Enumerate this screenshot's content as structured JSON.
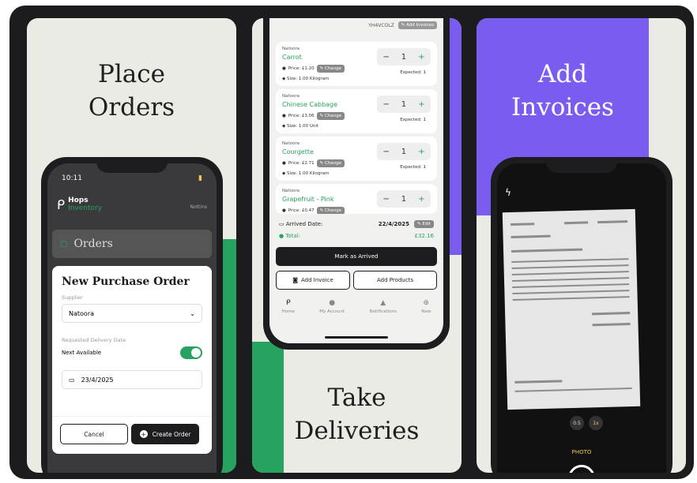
{
  "panel1": {
    "headline_line1": "Place",
    "headline_line2": "Orders",
    "status_time": "10:11",
    "logo_top": "Hops",
    "logo_bottom": "Inventory",
    "header_right": "Nottins",
    "orders_title": "Orders",
    "modal_title": "New Purchase Order",
    "supplier_label": "Supplier",
    "supplier_value": "Natoora",
    "delivery_label": "Requested Delivery Date",
    "next_available_label": "Next Available",
    "next_available_on": true,
    "date_value": "23/4/2025",
    "cancel_label": "Cancel",
    "create_label": "Create Order"
  },
  "panel2": {
    "headline_line1": "Take",
    "headline_line2": "Deliveries",
    "top_ref": "YH4VCOLZ",
    "add_invoices_label": "Add Invoices",
    "items": [
      {
        "supplier": "Natoora",
        "name": "Carrot",
        "price": "Price: £1.20",
        "size": "Size: 1.00 Kilogram",
        "qty": "1",
        "expected": "Expected: 1"
      },
      {
        "supplier": "Natoora",
        "name": "Chinese Cabbage",
        "price": "Price: £3.06",
        "size": "Size: 1.00 Unit",
        "qty": "1",
        "expected": "Expected: 1"
      },
      {
        "supplier": "Natoora",
        "name": "Courgette",
        "price": "Price: £2.71",
        "size": "Size: 1.00 Kilogram",
        "qty": "1",
        "expected": "Expected: 1"
      },
      {
        "supplier": "Natoora",
        "name": "Grapefruit - Pink",
        "price": "Price: £0.47",
        "size": "",
        "qty": "1",
        "expected": ""
      }
    ],
    "change_label": "Change",
    "arrived_label": "Arrived Date:",
    "arrived_value": "22/4/2025",
    "edit_label": "Edit",
    "total_label": "Total:",
    "total_value": "£32.16",
    "mark_arrived_label": "Mark as Arrived",
    "add_invoice_label": "Add Invoice",
    "add_products_label": "Add Products",
    "tabs": [
      "Home",
      "My Account",
      "Notifications",
      "New"
    ]
  },
  "panel3": {
    "headline_line1": "Add",
    "headline_line2": "Invoices",
    "photo_label": "PHOTO",
    "zoom_1": "0.5",
    "zoom_2": "1x"
  },
  "colors": {
    "frame": "#1c1c1e",
    "panel_bg": "#ebebe6",
    "green": "#27a35f",
    "purple": "#7b5cf0"
  }
}
